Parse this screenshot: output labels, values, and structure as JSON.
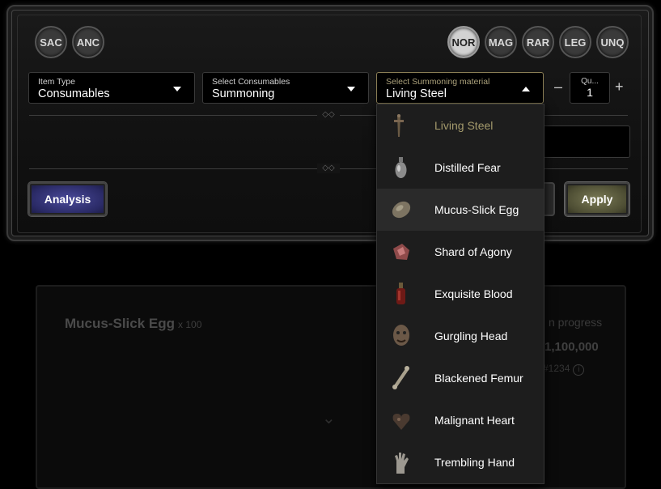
{
  "rarity": [
    "SAC",
    "ANC",
    "NOR",
    "MAG",
    "RAR",
    "LEG",
    "UNQ"
  ],
  "rarity_active": "NOR",
  "item_type": {
    "label": "Item Type",
    "value": "Consumables"
  },
  "consumables": {
    "label": "Select Consumables",
    "value": "Summoning"
  },
  "material": {
    "label": "Select Summoning material",
    "value": "Living Steel"
  },
  "quantity": {
    "label": "Qu...",
    "value": "1",
    "minus": "–",
    "plus": "+"
  },
  "buttons": {
    "analysis": "Analysis",
    "apply": "Apply"
  },
  "dropdown": [
    {
      "name": "Living Steel",
      "icon": "living-steel-icon"
    },
    {
      "name": "Distilled Fear",
      "icon": "distilled-fear-icon"
    },
    {
      "name": "Mucus-Slick Egg",
      "icon": "mucus-slick-egg-icon"
    },
    {
      "name": "Shard of Agony",
      "icon": "shard-of-agony-icon"
    },
    {
      "name": "Exquisite Blood",
      "icon": "exquisite-blood-icon"
    },
    {
      "name": "Gurgling Head",
      "icon": "gurgling-head-icon"
    },
    {
      "name": "Blackened Femur",
      "icon": "blackened-femur-icon"
    },
    {
      "name": "Malignant Heart",
      "icon": "malignant-heart-icon"
    },
    {
      "name": "Trembling Hand",
      "icon": "trembling-hand-icon"
    }
  ],
  "dropdown_hover": "Mucus-Slick Egg",
  "card": {
    "title": "Mucus-Slick Egg",
    "count": "x 100",
    "progress": "n progress",
    "price": "1,100,000",
    "code": "#1234"
  },
  "colors": {
    "selected_text": "#a49a6c",
    "analysis": "#3a3a88",
    "apply": "#5e5e40"
  }
}
